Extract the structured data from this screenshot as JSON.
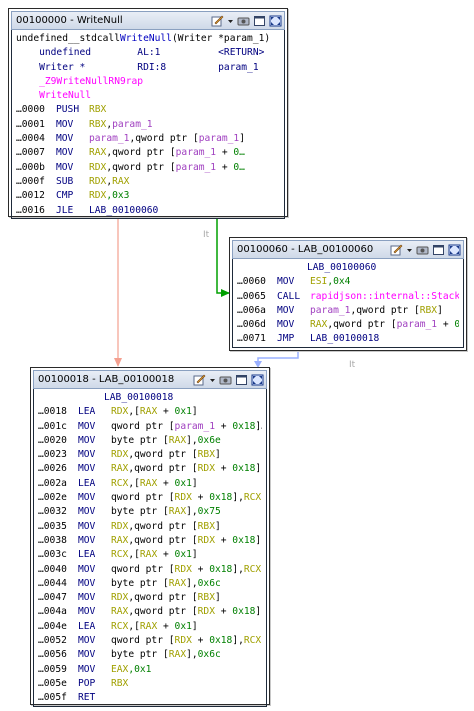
{
  "block1": {
    "title": "00100000 - WriteNull",
    "header": [
      [
        [
          "undefined__stdcall",
          "#000"
        ],
        [
          "WriteNull",
          "#0000c0"
        ],
        [
          "(Writer *param_1)",
          "#000"
        ]
      ],
      [
        [
          "    undefined        AL:1          <RETURN>",
          "#000080"
        ]
      ],
      [
        [
          "    Writer *         RDI:8         param_1",
          "#000080"
        ]
      ],
      [
        [
          "    _Z9WriteNullRN9rap",
          "#ff00ff"
        ]
      ],
      [
        [
          "    WriteNull",
          "#ff00ff"
        ]
      ]
    ],
    "rows": [
      {
        "addr": "…0000",
        "mn": "PUSH",
        "ops": [
          [
            "RBX",
            "#a0a000"
          ]
        ]
      },
      {
        "addr": "…0001",
        "mn": "MOV",
        "ops": [
          [
            "RBX",
            "#a0a000"
          ],
          [
            ",",
            "#000"
          ],
          [
            "param_1",
            "#a040c0"
          ]
        ]
      },
      {
        "addr": "…0004",
        "mn": "MOV",
        "ops": [
          [
            "param_1",
            "#a040c0"
          ],
          [
            ",qword ptr [",
            "#000"
          ],
          [
            "param_1",
            "#a040c0"
          ],
          [
            "]",
            "#000"
          ]
        ]
      },
      {
        "addr": "…0007",
        "mn": "MOV",
        "ops": [
          [
            "RAX",
            "#a0a000"
          ],
          [
            ",qword ptr [",
            "#000"
          ],
          [
            "param_1",
            "#a040c0"
          ],
          [
            " + ",
            "#000"
          ],
          [
            "0…",
            "#008000"
          ]
        ]
      },
      {
        "addr": "…000b",
        "mn": "MOV",
        "ops": [
          [
            "RDX",
            "#a0a000"
          ],
          [
            ",qword ptr [",
            "#000"
          ],
          [
            "param_1",
            "#a040c0"
          ],
          [
            " + ",
            "#000"
          ],
          [
            "0…",
            "#008000"
          ]
        ]
      },
      {
        "addr": "…000f",
        "mn": "SUB",
        "ops": [
          [
            "RDX",
            "#a0a000"
          ],
          [
            ",",
            "#000"
          ],
          [
            "RAX",
            "#a0a000"
          ]
        ]
      },
      {
        "addr": "…0012",
        "mn": "CMP",
        "ops": [
          [
            "RDX",
            "#a0a000"
          ],
          [
            ",0x3",
            "#008000"
          ]
        ]
      },
      {
        "addr": "…0016",
        "mn": "JLE",
        "ops": [
          [
            "LAB_00100060",
            "#000080"
          ]
        ]
      }
    ]
  },
  "block2": {
    "title": "00100060 - LAB_00100060",
    "label": "LAB_00100060",
    "rows": [
      {
        "addr": "…0060",
        "mn": "MOV",
        "ops": [
          [
            "ESI",
            "#a0a000"
          ],
          [
            ",0x4",
            "#008000"
          ]
        ]
      },
      {
        "addr": "…0065",
        "mn": "CALL",
        "ops": [
          [
            "rapidjson::internal::Stack",
            "#ff00ff"
          ]
        ]
      },
      {
        "addr": "…006a",
        "mn": "MOV",
        "ops": [
          [
            "param_1",
            "#a040c0"
          ],
          [
            ",qword ptr [",
            "#000"
          ],
          [
            "RBX",
            "#a0a000"
          ],
          [
            "]",
            "#000"
          ]
        ]
      },
      {
        "addr": "…006d",
        "mn": "MOV",
        "ops": [
          [
            "RAX",
            "#a0a000"
          ],
          [
            ",qword ptr [",
            "#000"
          ],
          [
            "param_1",
            "#a040c0"
          ],
          [
            " + ",
            "#000"
          ],
          [
            "0…",
            "#008000"
          ]
        ]
      },
      {
        "addr": "…0071",
        "mn": "JMP",
        "ops": [
          [
            "LAB_00100018",
            "#000080"
          ]
        ]
      }
    ]
  },
  "block3": {
    "title": "00100018 - LAB_00100018",
    "label": "LAB_00100018",
    "rows": [
      {
        "addr": "…0018",
        "mn": "LEA",
        "ops": [
          [
            "RDX",
            "#a0a000"
          ],
          [
            ",[",
            "#000"
          ],
          [
            "RAX",
            "#a0a000"
          ],
          [
            " + ",
            "#000"
          ],
          [
            "0x1",
            "#008000"
          ],
          [
            "]",
            "#000"
          ]
        ]
      },
      {
        "addr": "…001c",
        "mn": "MOV",
        "ops": [
          [
            "qword ptr [",
            "#000"
          ],
          [
            "param_1",
            "#a040c0"
          ],
          [
            " + ",
            "#000"
          ],
          [
            "0x18",
            "#008000"
          ],
          [
            "]…",
            "#000"
          ]
        ]
      },
      {
        "addr": "…0020",
        "mn": "MOV",
        "ops": [
          [
            "byte ptr [",
            "#000"
          ],
          [
            "RAX",
            "#a0a000"
          ],
          [
            "],",
            "#000"
          ],
          [
            "0x6e",
            "#008000"
          ]
        ]
      },
      {
        "addr": "…0023",
        "mn": "MOV",
        "ops": [
          [
            "RDX",
            "#a0a000"
          ],
          [
            ",qword ptr [",
            "#000"
          ],
          [
            "RBX",
            "#a0a000"
          ],
          [
            "]",
            "#000"
          ]
        ]
      },
      {
        "addr": "…0026",
        "mn": "MOV",
        "ops": [
          [
            "RAX",
            "#a0a000"
          ],
          [
            ",qword ptr [",
            "#000"
          ],
          [
            "RDX",
            "#a0a000"
          ],
          [
            " + ",
            "#000"
          ],
          [
            "0x18",
            "#008000"
          ],
          [
            "]",
            "#000"
          ]
        ]
      },
      {
        "addr": "…002a",
        "mn": "LEA",
        "ops": [
          [
            "RCX",
            "#a0a000"
          ],
          [
            ",[",
            "#000"
          ],
          [
            "RAX",
            "#a0a000"
          ],
          [
            " + ",
            "#000"
          ],
          [
            "0x1",
            "#008000"
          ],
          [
            "]",
            "#000"
          ]
        ]
      },
      {
        "addr": "…002e",
        "mn": "MOV",
        "ops": [
          [
            "qword ptr [",
            "#000"
          ],
          [
            "RDX",
            "#a0a000"
          ],
          [
            " + ",
            "#000"
          ],
          [
            "0x18",
            "#008000"
          ],
          [
            "],",
            "#000"
          ],
          [
            "RCX",
            "#a0a000"
          ]
        ]
      },
      {
        "addr": "…0032",
        "mn": "MOV",
        "ops": [
          [
            "byte ptr [",
            "#000"
          ],
          [
            "RAX",
            "#a0a000"
          ],
          [
            "],",
            "#000"
          ],
          [
            "0x75",
            "#008000"
          ]
        ]
      },
      {
        "addr": "…0035",
        "mn": "MOV",
        "ops": [
          [
            "RDX",
            "#a0a000"
          ],
          [
            ",qword ptr [",
            "#000"
          ],
          [
            "RBX",
            "#a0a000"
          ],
          [
            "]",
            "#000"
          ]
        ]
      },
      {
        "addr": "…0038",
        "mn": "MOV",
        "ops": [
          [
            "RAX",
            "#a0a000"
          ],
          [
            ",qword ptr [",
            "#000"
          ],
          [
            "RDX",
            "#a0a000"
          ],
          [
            " + ",
            "#000"
          ],
          [
            "0x18",
            "#008000"
          ],
          [
            "]",
            "#000"
          ]
        ]
      },
      {
        "addr": "…003c",
        "mn": "LEA",
        "ops": [
          [
            "RCX",
            "#a0a000"
          ],
          [
            ",[",
            "#000"
          ],
          [
            "RAX",
            "#a0a000"
          ],
          [
            " + ",
            "#000"
          ],
          [
            "0x1",
            "#008000"
          ],
          [
            "]",
            "#000"
          ]
        ]
      },
      {
        "addr": "…0040",
        "mn": "MOV",
        "ops": [
          [
            "qword ptr [",
            "#000"
          ],
          [
            "RDX",
            "#a0a000"
          ],
          [
            " + ",
            "#000"
          ],
          [
            "0x18",
            "#008000"
          ],
          [
            "],",
            "#000"
          ],
          [
            "RCX",
            "#a0a000"
          ]
        ]
      },
      {
        "addr": "…0044",
        "mn": "MOV",
        "ops": [
          [
            "byte ptr [",
            "#000"
          ],
          [
            "RAX",
            "#a0a000"
          ],
          [
            "],",
            "#000"
          ],
          [
            "0x6c",
            "#008000"
          ]
        ]
      },
      {
        "addr": "…0047",
        "mn": "MOV",
        "ops": [
          [
            "RDX",
            "#a0a000"
          ],
          [
            ",qword ptr [",
            "#000"
          ],
          [
            "RBX",
            "#a0a000"
          ],
          [
            "]",
            "#000"
          ]
        ]
      },
      {
        "addr": "…004a",
        "mn": "MOV",
        "ops": [
          [
            "RAX",
            "#a0a000"
          ],
          [
            ",qword ptr [",
            "#000"
          ],
          [
            "RDX",
            "#a0a000"
          ],
          [
            " + ",
            "#000"
          ],
          [
            "0x18",
            "#008000"
          ],
          [
            "]",
            "#000"
          ]
        ]
      },
      {
        "addr": "…004e",
        "mn": "LEA",
        "ops": [
          [
            "RCX",
            "#a0a000"
          ],
          [
            ",[",
            "#000"
          ],
          [
            "RAX",
            "#a0a000"
          ],
          [
            " + ",
            "#000"
          ],
          [
            "0x1",
            "#008000"
          ],
          [
            "]",
            "#000"
          ]
        ]
      },
      {
        "addr": "…0052",
        "mn": "MOV",
        "ops": [
          [
            "qword ptr [",
            "#000"
          ],
          [
            "RDX",
            "#a0a000"
          ],
          [
            " + ",
            "#000"
          ],
          [
            "0x18",
            "#008000"
          ],
          [
            "],",
            "#000"
          ],
          [
            "RCX",
            "#a0a000"
          ]
        ]
      },
      {
        "addr": "…0056",
        "mn": "MOV",
        "ops": [
          [
            "byte ptr [",
            "#000"
          ],
          [
            "RAX",
            "#a0a000"
          ],
          [
            "],",
            "#000"
          ],
          [
            "0x6c",
            "#008000"
          ]
        ]
      },
      {
        "addr": "…0059",
        "mn": "MOV",
        "ops": [
          [
            "EAX",
            "#a0a000"
          ],
          [
            ",0x1",
            "#008000"
          ]
        ]
      },
      {
        "addr": "…005e",
        "mn": "POP",
        "ops": [
          [
            "RBX",
            "#a0a000"
          ]
        ]
      },
      {
        "addr": "…005f",
        "mn": "RET",
        "ops": []
      }
    ]
  },
  "edge_labels": {
    "true_branch_1": "It",
    "true_branch_2": "It"
  },
  "colors": {
    "edge_false": "#f4a090",
    "edge_true": "#00a000",
    "edge_jump": "#9ab0ff"
  },
  "icons": [
    "edit-icon",
    "dropdown-icon",
    "snapshot-icon",
    "restore-icon",
    "maximize-icon"
  ]
}
